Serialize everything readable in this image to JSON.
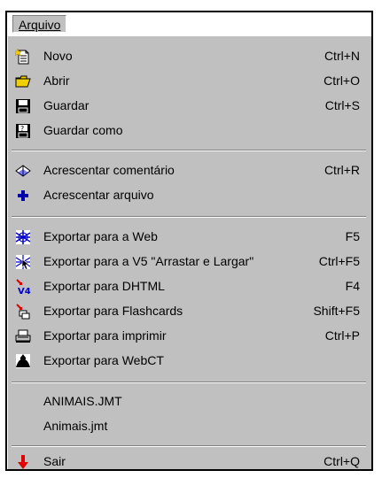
{
  "menubar": {
    "arquivo_label": "Arquivo"
  },
  "menu": {
    "novo": {
      "label": "Novo",
      "shortcut": "Ctrl+N",
      "icon": "new-document-icon"
    },
    "abrir": {
      "label": "Abrir",
      "shortcut": "Ctrl+O",
      "icon": "open-folder-icon"
    },
    "guardar": {
      "label": "Guardar",
      "shortcut": "Ctrl+S",
      "icon": "floppy-disk-icon"
    },
    "guardar_como": {
      "label": "Guardar como",
      "shortcut": "",
      "icon": "save-as-icon"
    },
    "acr_comentario": {
      "label": "Acrescentar comentário",
      "shortcut": "Ctrl+R",
      "icon": "comment-book-icon"
    },
    "acr_arquivo": {
      "label": "Acrescentar arquivo",
      "shortcut": "",
      "icon": "plus-icon"
    },
    "exp_web": {
      "label": "Exportar para a Web",
      "shortcut": "F5",
      "icon": "web-export-icon"
    },
    "exp_v5": {
      "label": "Exportar para a V5 \"Arrastar e Largar\"",
      "shortcut": "Ctrl+F5",
      "icon": "drag-drop-export-icon"
    },
    "exp_dhtml": {
      "label": "Exportar para DHTML",
      "shortcut": "F4",
      "icon": "dhtml-export-icon"
    },
    "exp_flashcards": {
      "label": "Exportar para Flashcards",
      "shortcut": "Shift+F5",
      "icon": "flashcards-export-icon"
    },
    "exp_imprimir": {
      "label": "Exportar para  imprimir",
      "shortcut": "Ctrl+P",
      "icon": "printer-icon"
    },
    "exp_webct": {
      "label": "Exportar para WebCT",
      "shortcut": "",
      "icon": "webct-icon"
    },
    "recent1": {
      "label": "ANIMAIS.JMT"
    },
    "recent2": {
      "label": "Animais.jmt"
    },
    "sair": {
      "label": "Sair",
      "shortcut": "Ctrl+Q",
      "icon": "exit-arrow-icon"
    }
  },
  "colors": {
    "menu_bg": "#c0c0c0",
    "menubar_bg": "#ffffff",
    "icon_blue": "#0000cc",
    "icon_red": "#e00000",
    "icon_yellow": "#f0d000"
  }
}
